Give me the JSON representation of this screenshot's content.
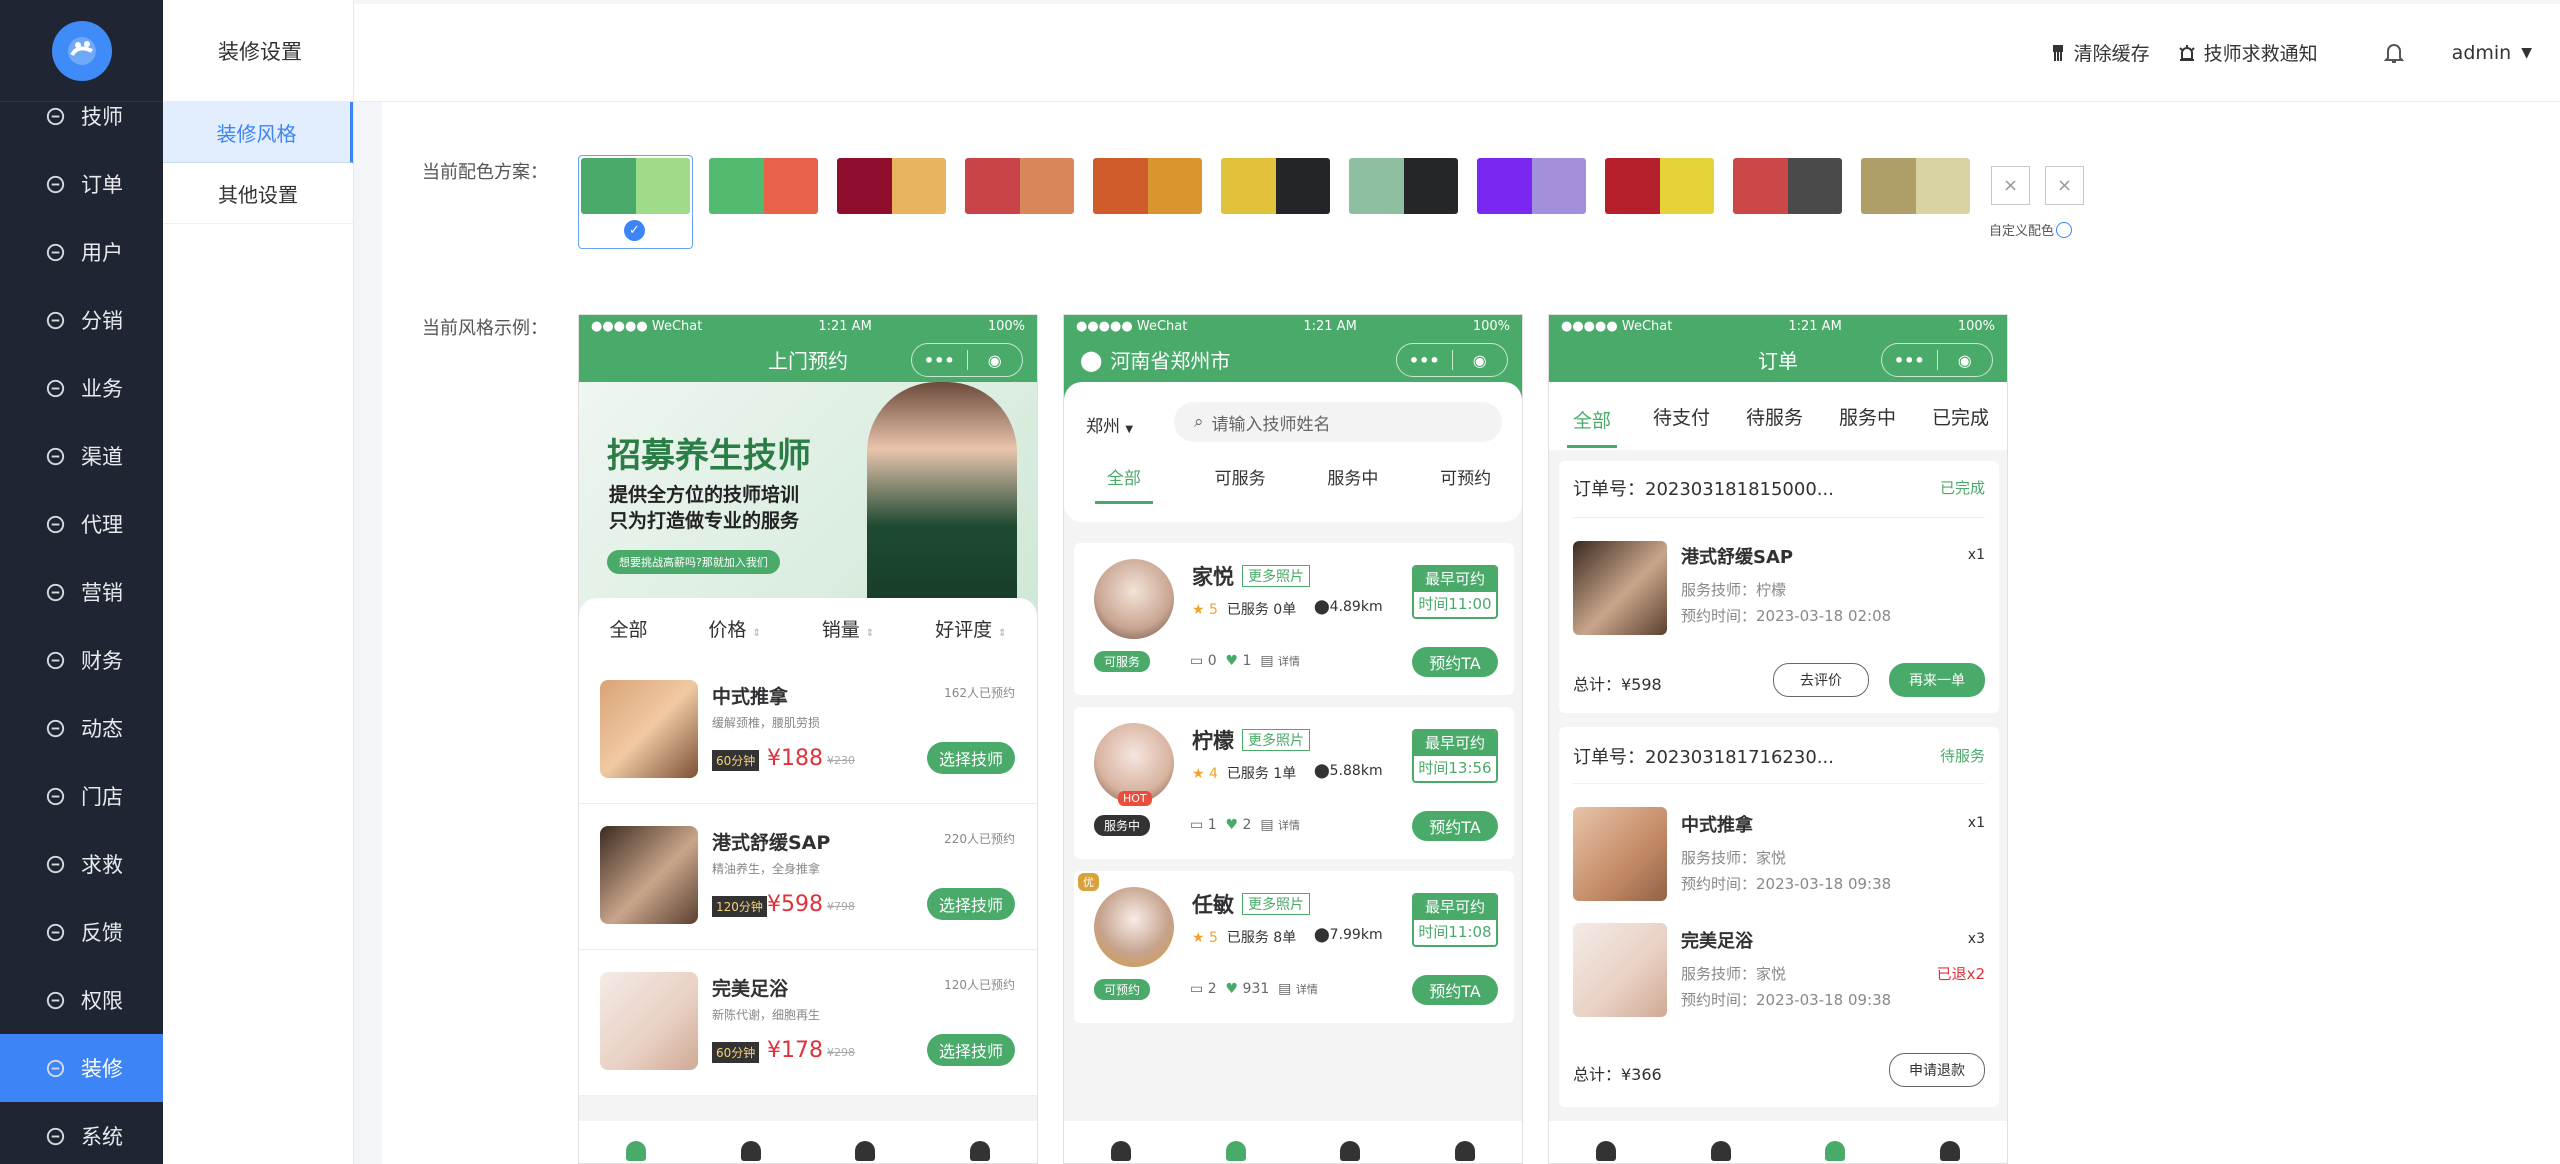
{
  "sidebar": {
    "items": [
      {
        "label": "技师",
        "icon": "technician-icon"
      },
      {
        "label": "订单",
        "icon": "order-icon"
      },
      {
        "label": "用户",
        "icon": "user-icon"
      },
      {
        "label": "分销",
        "icon": "distribution-icon"
      },
      {
        "label": "业务",
        "icon": "business-icon"
      },
      {
        "label": "渠道",
        "icon": "channel-icon"
      },
      {
        "label": "代理",
        "icon": "agent-icon"
      },
      {
        "label": "营销",
        "icon": "marketing-icon"
      },
      {
        "label": "财务",
        "icon": "finance-icon"
      },
      {
        "label": "动态",
        "icon": "dynamic-icon"
      },
      {
        "label": "门店",
        "icon": "store-icon"
      },
      {
        "label": "求救",
        "icon": "sos-icon"
      },
      {
        "label": "反馈",
        "icon": "feedback-icon"
      },
      {
        "label": "权限",
        "icon": "permission-icon"
      },
      {
        "label": "装修",
        "icon": "decoration-icon",
        "active": true
      },
      {
        "label": "系统",
        "icon": "system-icon"
      }
    ]
  },
  "subnav": {
    "title": "装修设置",
    "items": [
      "装修风格",
      "其他设置"
    ]
  },
  "topbar": {
    "clear_cache": "清除缓存",
    "sos_notice": "技师求救通知",
    "user": "admin"
  },
  "main": {
    "scheme_label": "当前配色方案：",
    "example_label": "当前风格示例：",
    "custom_label": "自定义配色",
    "swatches": [
      [
        "#4aaa6a",
        "#9fdc8a"
      ],
      [
        "#53bb6f",
        "#e8624a"
      ],
      [
        "#8f0e2d",
        "#e8b460"
      ],
      [
        "#c84448",
        "#d8865a"
      ],
      [
        "#cf5a2a",
        "#d9962f"
      ],
      [
        "#e2c23b",
        "#232528"
      ],
      [
        "#8ebfa1",
        "#242627"
      ],
      [
        "#7a27f2",
        "#a38fdc"
      ],
      [
        "#b61f2c",
        "#e6d33a"
      ],
      [
        "#cc4748",
        "#4a4a4a"
      ],
      [
        "#b09e68",
        "#d9d3a3"
      ]
    ]
  },
  "phone1": {
    "status_left": "●●●●● WeChat",
    "status_time": "1:21 AM",
    "status_right": "100%",
    "title": "上门预约",
    "banner_title": "招募养生技师",
    "banner_l1": "提供全方位的技师培训",
    "banner_l2": "只为打造做专业的服务",
    "banner_pill": "想要挑战高薪吗?那就加入我们",
    "filters": [
      "全部",
      "价格",
      "销量",
      "好评度"
    ],
    "services": [
      {
        "name": "中式推拿",
        "desc": "缓解颈椎，腰肌劳损",
        "count": "162人已预约",
        "dur": "60分钟",
        "price": "¥188",
        "old": "¥230",
        "btn": "选择技师"
      },
      {
        "name": "港式舒缓SAP",
        "desc": "精油养生，全身推拿",
        "count": "220人已预约",
        "dur": "120分钟",
        "price": "¥598",
        "old": "¥798",
        "btn": "选择技师"
      },
      {
        "name": "完美足浴",
        "desc": "新陈代谢，细胞再生",
        "count": "120人已预约",
        "dur": "60分钟",
        "price": "¥178",
        "old": "¥298",
        "btn": "选择技师"
      }
    ]
  },
  "phone2": {
    "location": "河南省郑州市",
    "city": "郑州",
    "search_ph": "请输入技师姓名",
    "tabs": [
      "全部",
      "可服务",
      "服务中",
      "可预约"
    ],
    "techs": [
      {
        "name": "家悦",
        "more": "更多照片",
        "rating": "5",
        "served": "已服务 0单",
        "dist": "4.89km",
        "early": "最早可约",
        "time": "时间11:00",
        "status": "可服务",
        "comments": "0",
        "likes": "1",
        "detail": "详情",
        "btn": "预约TA"
      },
      {
        "name": "柠檬",
        "more": "更多照片",
        "rating": "4",
        "served": "已服务 1单",
        "dist": "5.88km",
        "early": "最早可约",
        "time": "时间13:56",
        "status": "服务中",
        "comments": "1",
        "likes": "2",
        "detail": "详情",
        "btn": "预约TA",
        "badge": "HOT"
      },
      {
        "name": "任敏",
        "more": "更多照片",
        "rating": "5",
        "served": "已服务 8单",
        "dist": "7.99km",
        "early": "最早可约",
        "time": "时间11:08",
        "status": "可预约",
        "comments": "2",
        "likes": "931",
        "detail": "详情",
        "btn": "预约TA",
        "badge": "优"
      }
    ]
  },
  "phone3": {
    "title": "订单",
    "tabs": [
      "全部",
      "待支付",
      "待服务",
      "服务中",
      "已完成"
    ],
    "orders": [
      {
        "no": "订单号：202303181815000...",
        "state": "已完成",
        "items": [
          {
            "name": "港式舒缓SAP",
            "qty": "x1",
            "tech": "服务技师：柠檬",
            "time": "预约时间：2023-03-18 02:08"
          }
        ],
        "total": "总计：¥598",
        "btn1": "去评价",
        "btn2": "再来一单"
      },
      {
        "no": "订单号：202303181716230...",
        "state": "待服务",
        "items": [
          {
            "name": "中式推拿",
            "qty": "x1",
            "tech": "服务技师：家悦",
            "time": "预约时间：2023-03-18 09:38"
          },
          {
            "name": "完美足浴",
            "qty": "x3",
            "tech": "服务技师：家悦",
            "time": "预约时间：2023-03-18 09:38",
            "refund": "已退x2"
          }
        ],
        "total": "总计：¥366",
        "btn1": "申请退款"
      }
    ]
  }
}
